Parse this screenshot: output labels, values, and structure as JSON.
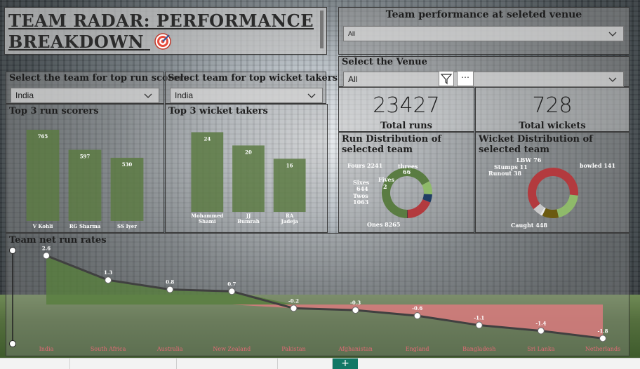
{
  "header": {
    "title": "TEAM RADAR: PERFORMANCE BREAKDOWN"
  },
  "venue_panel": {
    "label": "Team performance at seleted venue",
    "dropdown_value": "All"
  },
  "venue_select": {
    "label": "Select the Venue",
    "dropdown_value": "All"
  },
  "run_team_filter": {
    "label": "Select the team for top run scorers",
    "value": "India"
  },
  "wicket_team_filter": {
    "label": "Select team for top wicket takers",
    "value": "India"
  },
  "kpis": [
    {
      "value": "23427",
      "caption": "Total runs"
    },
    {
      "value": "728",
      "caption": "Total wickets"
    }
  ],
  "colors": {
    "bar": "#5c7a43",
    "positive_area": "#587e3d",
    "negative_area": "#e07a80",
    "line": "#404040",
    "caught": "#b33a3e",
    "bowled": "#8fba6a",
    "lbw": "#6b5a10"
  },
  "chart_data": [
    {
      "type": "bar",
      "title": "Top 3 run scorers",
      "categories": [
        "V Kohli",
        "RG Sharma",
        "SS Iyer"
      ],
      "values": [
        765,
        597,
        530
      ],
      "ylim": [
        0,
        800
      ]
    },
    {
      "type": "bar",
      "title": "Top 3 wicket takers",
      "categories": [
        "Mohammed Shami",
        "JJ Bumrah",
        "RA Jadeja"
      ],
      "values": [
        24,
        20,
        16
      ],
      "ylim": [
        0,
        26
      ]
    },
    {
      "type": "pie",
      "title": "Run Distribution of selected team",
      "categories": [
        "Ones",
        "Twos",
        "Sixes",
        "Fives",
        "Fours",
        "threes"
      ],
      "values": [
        8265,
        1063,
        644,
        2,
        2241,
        66
      ],
      "colors": [
        "#5a7c42",
        "#8fba6a",
        "#1f3d64",
        "#2a2a2a",
        "#b33a3e",
        "#4e3a3a"
      ]
    },
    {
      "type": "pie",
      "title": "Wicket Distribution of selected team",
      "categories": [
        "Caught",
        "bowled",
        "LBW",
        "Stumps",
        "Runout"
      ],
      "values": [
        448,
        141,
        76,
        11,
        38
      ],
      "colors": [
        "#b33a3e",
        "#8fba6a",
        "#6b5a10",
        "#e8e8e8",
        "#c9c9c9"
      ]
    },
    {
      "type": "area",
      "title": "Team net run rates",
      "categories": [
        "India",
        "South Africa",
        "Australia",
        "New Zealand",
        "Pakistan",
        "Afghanistan",
        "England",
        "Bangladesh",
        "Sri Lanka",
        "Netherlands"
      ],
      "values": [
        2.6,
        1.3,
        0.8,
        0.7,
        -0.2,
        -0.3,
        -0.6,
        -1.1,
        -1.4,
        -1.8
      ],
      "ylim": [
        -1.9,
        2.8
      ]
    }
  ],
  "pie_labels": {
    "runs": [
      "Fours 2241",
      "threes",
      "66",
      "Sixes",
      "644",
      "Fives",
      "2",
      "Twos",
      "1063",
      "Ones 8265"
    ],
    "wickets": [
      "LBW 76",
      "Stumps 11",
      "Runout 38",
      "bowled 141",
      "Caught 448"
    ]
  }
}
